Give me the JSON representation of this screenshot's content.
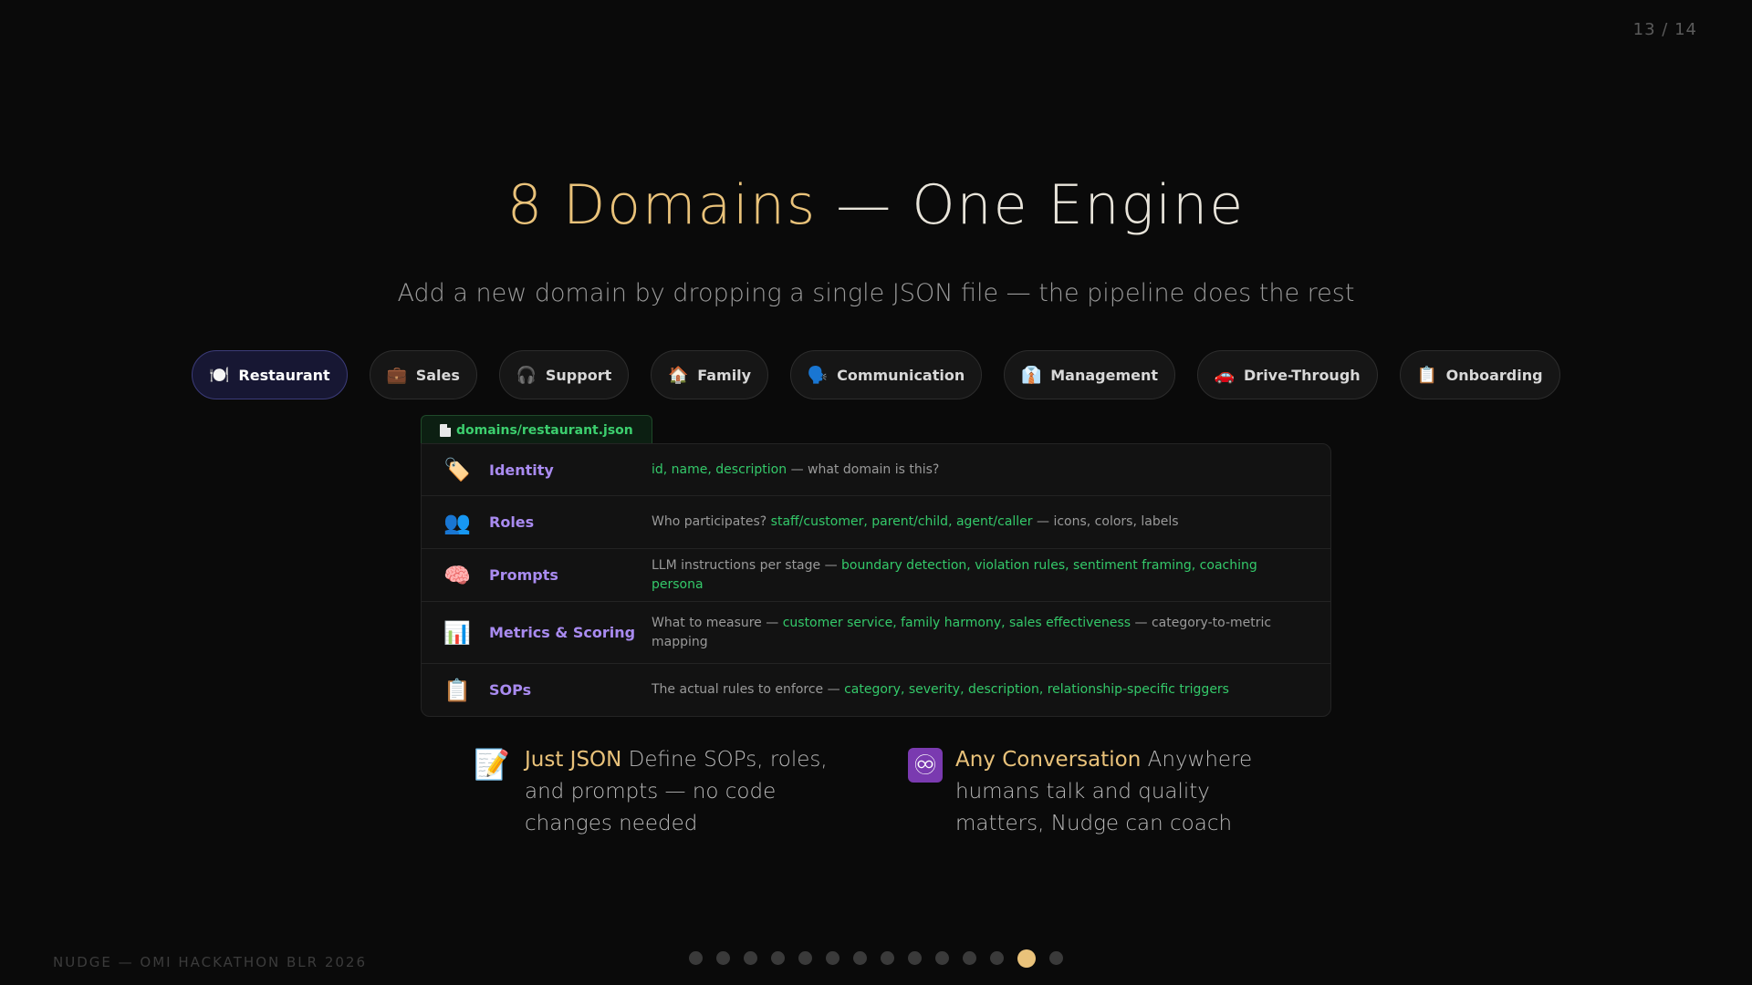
{
  "page_counter": "13 / 14",
  "title": {
    "accent": "8 Domains",
    "rest": " — One Engine"
  },
  "subtitle": "Add a new domain by dropping a single JSON file — the pipeline does the rest",
  "tabs": [
    {
      "icon": "🍽️",
      "label": "Restaurant",
      "active": true
    },
    {
      "icon": "💼",
      "label": "Sales"
    },
    {
      "icon": "🎧",
      "label": "Support"
    },
    {
      "icon": "🏠",
      "label": "Family"
    },
    {
      "icon": "🗣️",
      "label": "Communication"
    },
    {
      "icon": "👔",
      "label": "Management"
    },
    {
      "icon": "🚗",
      "label": "Drive-Through"
    },
    {
      "icon": "📋",
      "label": "Onboarding"
    }
  ],
  "file_tab": {
    "label": "domains/restaurant.json"
  },
  "schema_rows": [
    {
      "icon": "🏷️",
      "name": "Identity",
      "desc_parts": [
        {
          "text": "id, name, description",
          "hl": true
        },
        {
          "text": " — what domain is this?",
          "hl": false
        }
      ]
    },
    {
      "icon": "👥",
      "name": "Roles",
      "desc_parts": [
        {
          "text": "Who participates? ",
          "hl": false
        },
        {
          "text": "staff/customer, parent/child, agent/caller",
          "hl": true
        },
        {
          "text": " — icons, colors, labels",
          "hl": false
        }
      ]
    },
    {
      "icon": "🧠",
      "name": "Prompts",
      "desc_parts": [
        {
          "text": "LLM instructions per stage — ",
          "hl": false
        },
        {
          "text": "boundary detection, violation rules, sentiment framing, coaching persona",
          "hl": true
        }
      ]
    },
    {
      "icon": "📊",
      "name": "Metrics & Scoring",
      "desc_parts": [
        {
          "text": "What to measure — ",
          "hl": false
        },
        {
          "text": "customer service, family harmony, sales effectiveness",
          "hl": true
        },
        {
          "text": " — category-to-metric mapping",
          "hl": false
        }
      ]
    },
    {
      "icon": "📋",
      "name": "SOPs",
      "desc_parts": [
        {
          "text": "The actual rules to enforce — ",
          "hl": false
        },
        {
          "text": "category, severity, description, relationship-specific triggers",
          "hl": true
        }
      ]
    }
  ],
  "features": [
    {
      "icon": "📝",
      "icon_name": "memo-icon",
      "title": "Just JSON",
      "text": " Define SOPs, roles, and prompts — no code changes needed"
    },
    {
      "icon": "♾",
      "icon_name": "infinity-icon",
      "title": "Any Conversation",
      "text": " Anywhere humans talk and quality matters, Nudge can coach"
    }
  ],
  "footer": "NUDGE — OMI HACKATHON BLR 2026",
  "slides": {
    "total": 14,
    "current": 13
  }
}
